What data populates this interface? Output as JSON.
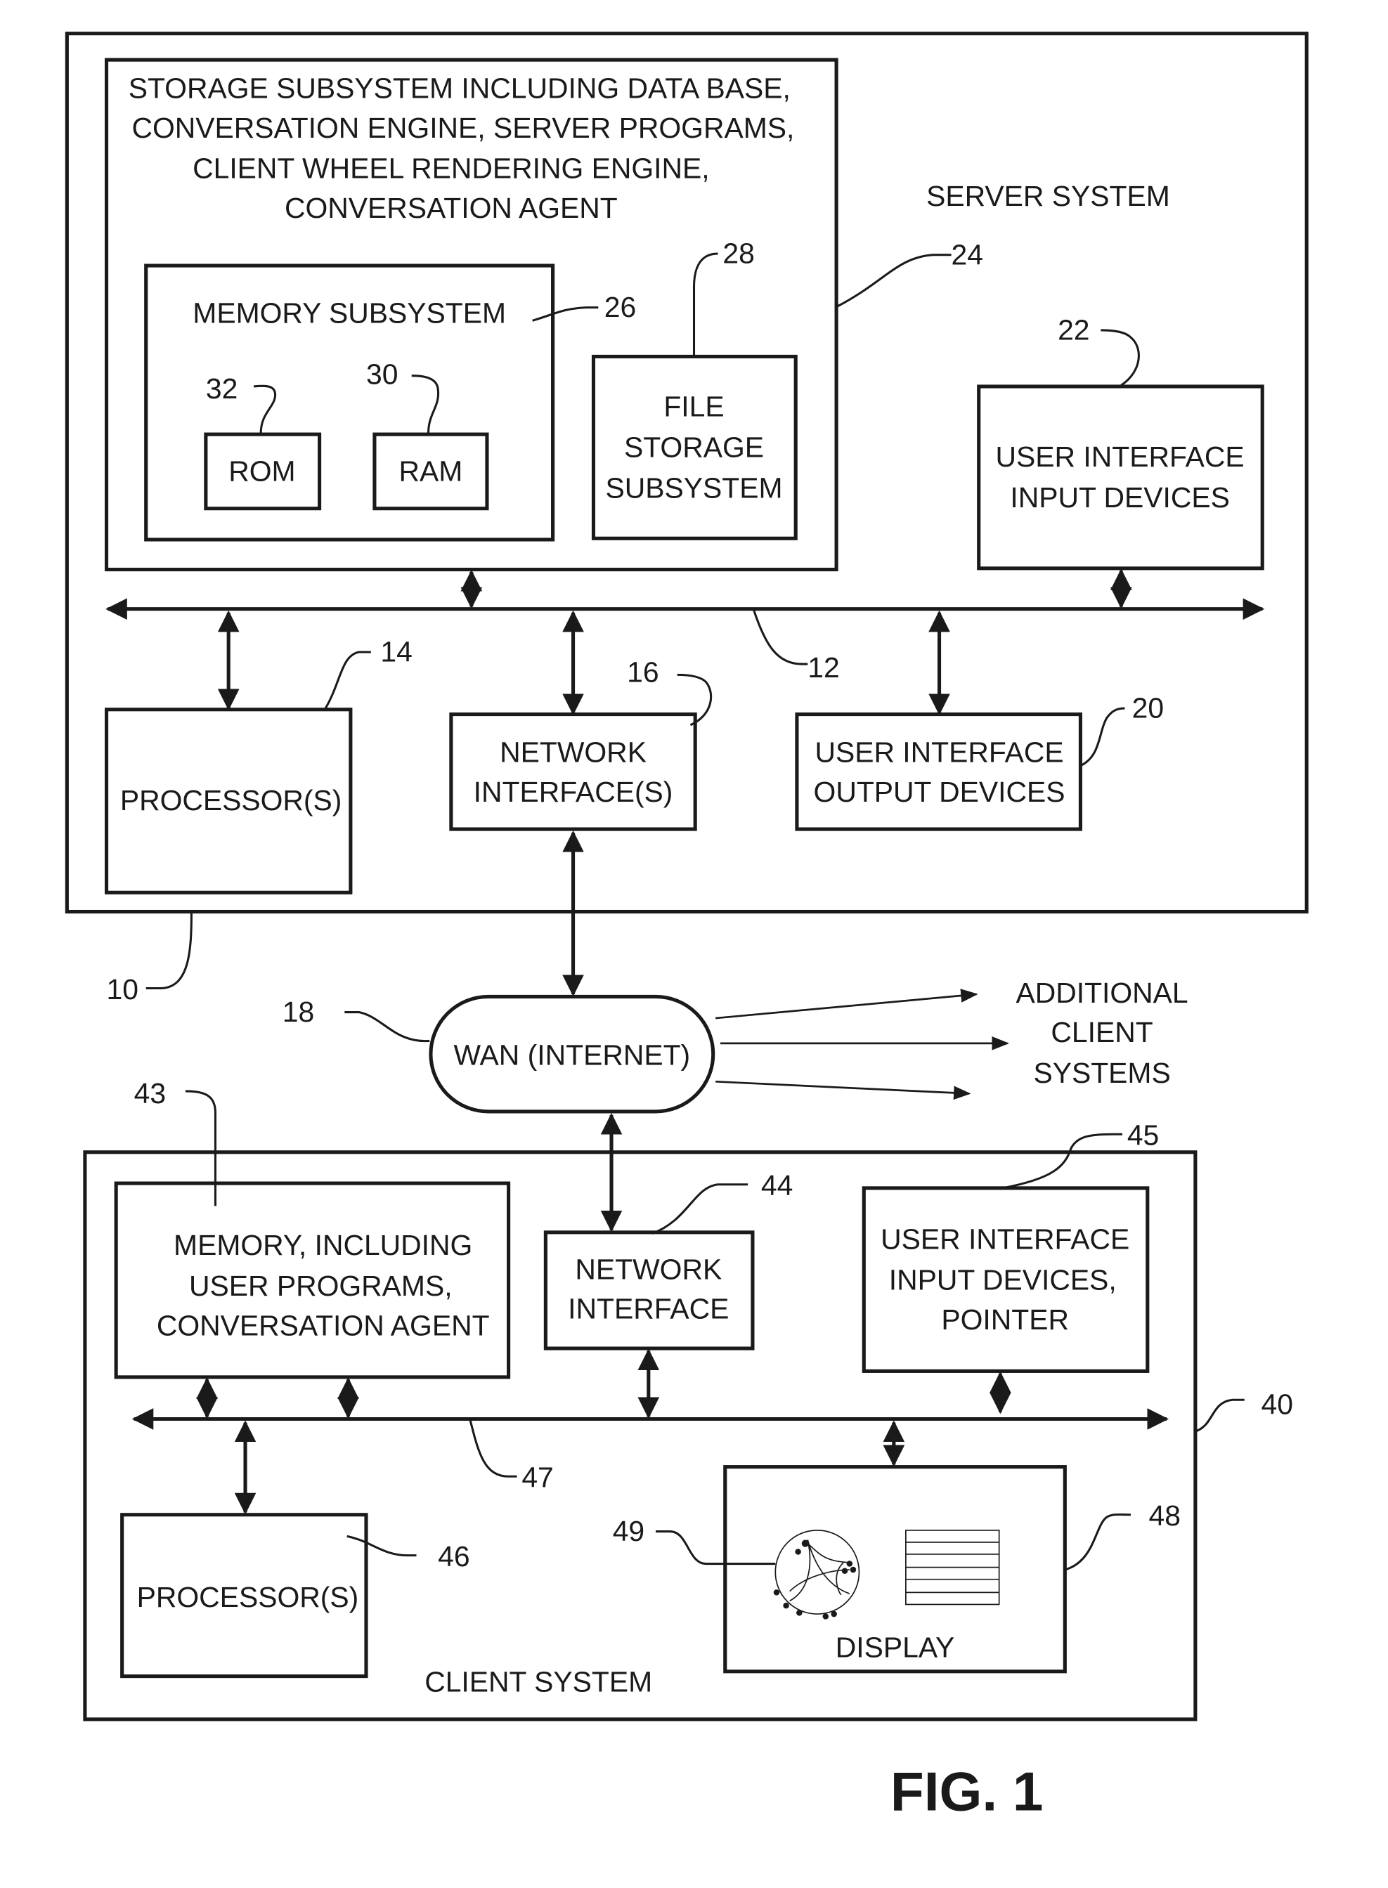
{
  "figure_label": "FIG. 1",
  "server": {
    "title": "SERVER SYSTEM",
    "ref": "10",
    "bus_ref": "12",
    "storage": {
      "lines": [
        "STORAGE SUBSYSTEM INCLUDING DATA BASE,",
        "CONVERSATION ENGINE, SERVER PROGRAMS,",
        "CLIENT WHEEL RENDERING ENGINE,",
        "CONVERSATION AGENT"
      ],
      "ref": "24"
    },
    "memory": {
      "label": "MEMORY SUBSYSTEM",
      "ref": "26"
    },
    "rom": {
      "label": "ROM",
      "ref": "32"
    },
    "ram": {
      "label": "RAM",
      "ref": "30"
    },
    "file_storage": {
      "lines": [
        "FILE",
        "STORAGE",
        "SUBSYSTEM"
      ],
      "ref": "28"
    },
    "ui_input": {
      "lines": [
        "USER INTERFACE",
        "INPUT DEVICES"
      ],
      "ref": "22"
    },
    "processor": {
      "label": "PROCESSOR(S)",
      "ref": "14"
    },
    "network": {
      "lines": [
        "NETWORK",
        "INTERFACE(S)"
      ],
      "ref": "16"
    },
    "ui_output": {
      "lines": [
        "USER INTERFACE",
        "OUTPUT DEVICES"
      ],
      "ref": "20"
    }
  },
  "wan": {
    "label": "WAN (INTERNET)",
    "ref": "18"
  },
  "additional_clients": {
    "lines": [
      "ADDITIONAL",
      "CLIENT",
      "SYSTEMS"
    ]
  },
  "client": {
    "title": "CLIENT  SYSTEM",
    "ref": "40",
    "bus_ref": "47",
    "memory": {
      "lines": [
        "MEMORY, INCLUDING",
        "USER PROGRAMS,",
        "CONVERSATION AGENT"
      ],
      "ref": "43"
    },
    "network": {
      "lines": [
        "NETWORK",
        "INTERFACE"
      ],
      "ref": "44"
    },
    "ui_input": {
      "lines": [
        "USER INTERFACE",
        "INPUT DEVICES,",
        "POINTER"
      ],
      "ref": "45"
    },
    "processor": {
      "label": "PROCESSOR(S)",
      "ref": "46"
    },
    "display": {
      "label": "DISPLAY",
      "ref": "48",
      "wheel_ref": "49"
    }
  }
}
